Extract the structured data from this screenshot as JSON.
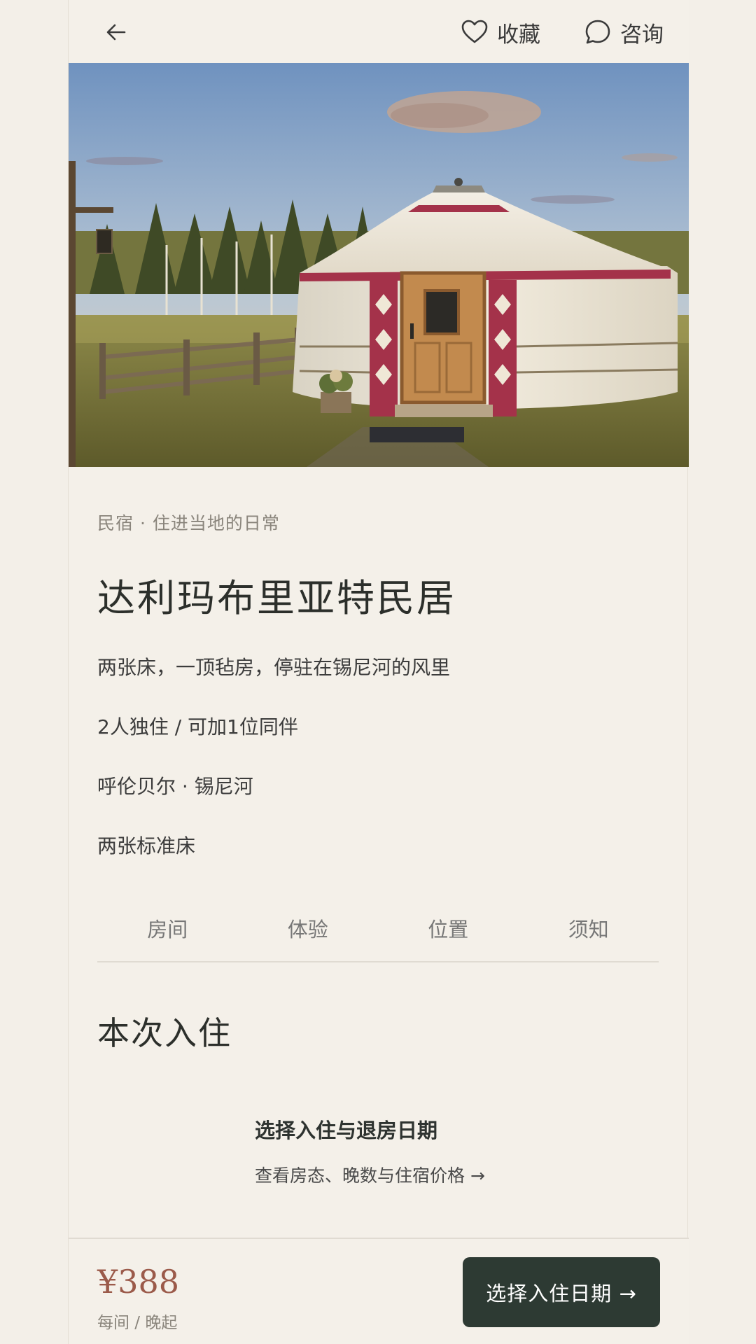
{
  "topbar": {
    "favorite_label": "收藏",
    "consult_label": "咨询"
  },
  "listing": {
    "category": "民宿 · 住进当地的日常",
    "title": "达利玛布里亚特民居",
    "tagline": "两张床，一顶毡房，停驻在锡尼河的风里",
    "capacity": "2人独住 / 可加1位同伴",
    "location": "呼伦贝尔 · 锡尼河",
    "beds": "两张标准床"
  },
  "tabs": [
    "房间",
    "体验",
    "位置",
    "须知"
  ],
  "stay": {
    "section_title": "本次入住",
    "pick_title": "选择入住与退房日期",
    "pick_subtitle": "查看房态、晚数与住宿价格 →"
  },
  "booking": {
    "price": "¥388",
    "price_unit": "每间 / 晚起",
    "cta_label": "选择入住日期 →"
  },
  "colors": {
    "accent_dark": "#2d3a33",
    "price": "#9b5a4a",
    "background": "#f4f0e9"
  }
}
